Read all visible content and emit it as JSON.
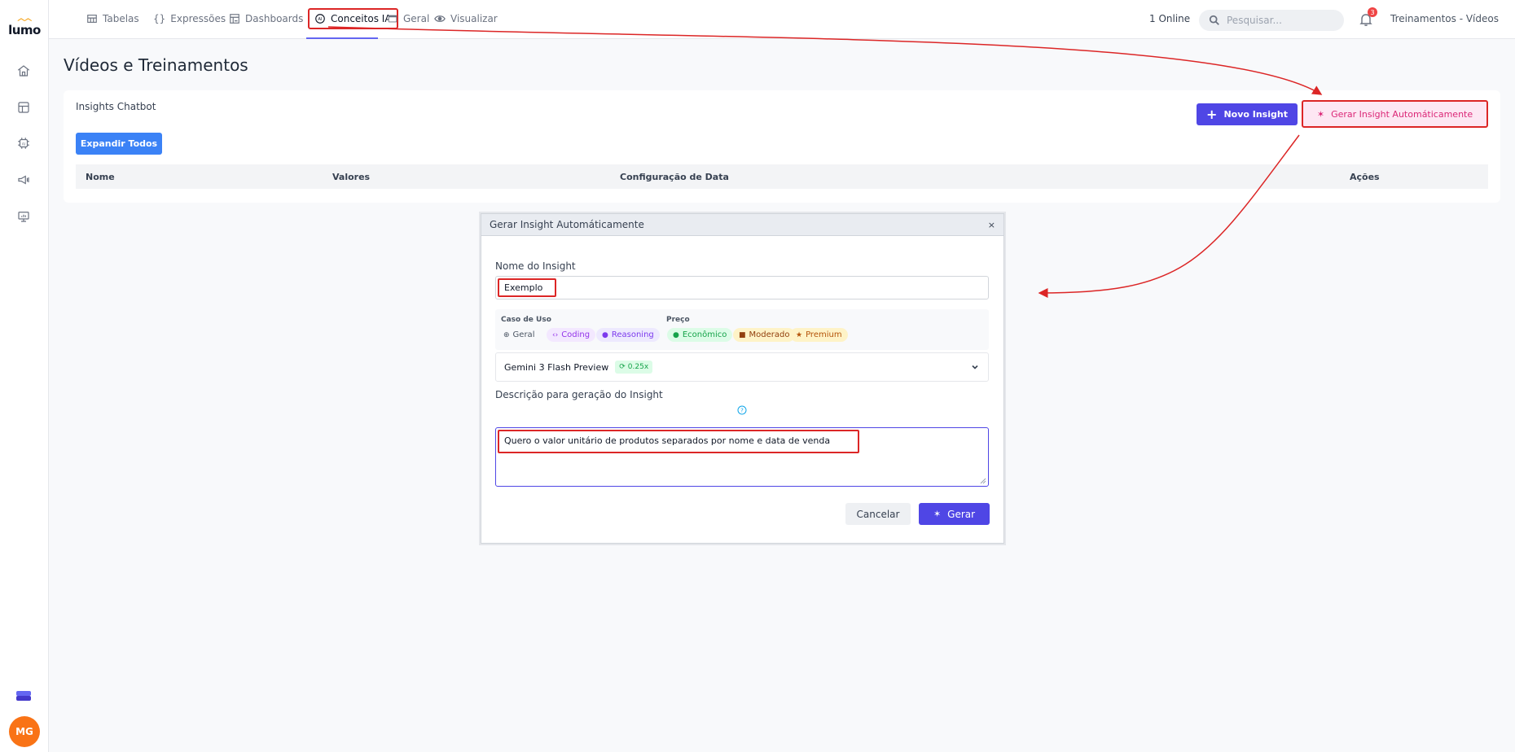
{
  "app": {
    "logo": "lumo"
  },
  "topnav": {
    "items": [
      {
        "label": "Tabelas",
        "icon": "table-icon"
      },
      {
        "label": "Expressões",
        "icon": "braces-icon"
      },
      {
        "label": "Dashboards",
        "icon": "dashboard-icon"
      },
      {
        "label": "Conceitos IA",
        "icon": "ai-chip-icon"
      },
      {
        "label": "Geral",
        "icon": "window-icon"
      },
      {
        "label": "Visualizar",
        "icon": "eye-icon"
      }
    ],
    "online": "1 Online",
    "search_placeholder": "Pesquisar...",
    "notification_count": "3",
    "workspace": "Treinamentos - Vídeos"
  },
  "user": {
    "initials": "MG"
  },
  "page": {
    "title": "Vídeos e Treinamentos"
  },
  "card": {
    "title": "Insights Chatbot",
    "expand_label": "Expandir Todos",
    "new_insight_label": "Novo Insight",
    "auto_insight_label": "Gerar Insight Automáticamente",
    "columns": [
      "Nome",
      "Valores",
      "Configuração de Data",
      "Ações"
    ]
  },
  "modal": {
    "title": "Gerar Insight Automáticamente",
    "close": "×",
    "name_label": "Nome do Insight",
    "name_value": "Exemplo",
    "use_case_title": "Caso de Uso",
    "use_cases": [
      "Geral",
      "Coding",
      "Reasoning"
    ],
    "price_title": "Preço",
    "prices": [
      "Econômico",
      "Moderado",
      "Premium"
    ],
    "model_name": "Gemini 3 Flash Preview",
    "model_multiplier": "0.25x",
    "description_label": "Descrição para geração do Insight",
    "description_value": "Quero o valor unitário de produtos separados por nome e data de venda",
    "cancel_label": "Cancelar",
    "generate_label": "Gerar"
  },
  "colors": {
    "primary": "#4f46e5",
    "accent_blue": "#3b82f6",
    "highlight_red": "#dc2626",
    "pink_bg": "#fde7f3",
    "pink_text": "#db2777",
    "avatar": "#f97316"
  }
}
